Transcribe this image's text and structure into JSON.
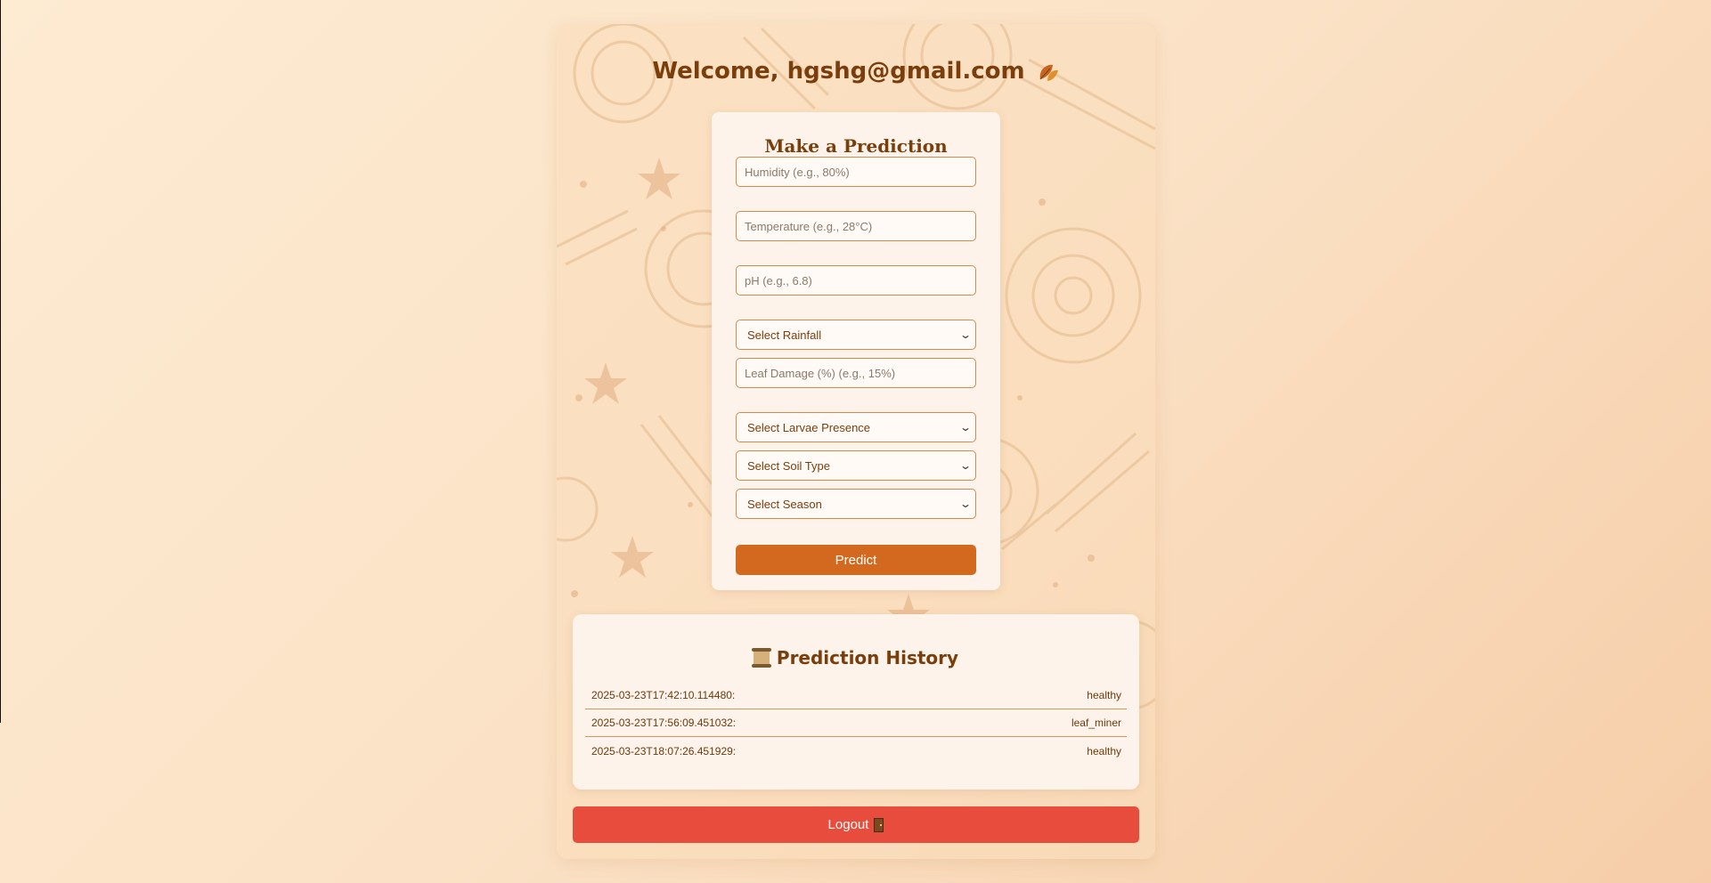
{
  "welcome": {
    "prefix": "Welcome, ",
    "email": "hgshg@gmail.com",
    "icon": "autumn-leaves-icon"
  },
  "form": {
    "title": "Make a Prediction",
    "humidity_placeholder": "Humidity (e.g., 80%)",
    "temperature_placeholder": "Temperature (e.g., 28°C)",
    "ph_placeholder": "pH (e.g., 6.8)",
    "rainfall_select": "Select Rainfall",
    "leaf_damage_placeholder": "Leaf Damage (%) (e.g., 15%)",
    "larvae_select": "Select Larvae Presence",
    "soil_select": "Select Soil Type",
    "season_select": "Select Season",
    "predict_label": "Predict"
  },
  "history": {
    "title": "Prediction History",
    "icon": "scroll-icon",
    "items": [
      {
        "timestamp": "2025-03-23T17:42:10.114480:",
        "result": "healthy"
      },
      {
        "timestamp": "2025-03-23T17:56:09.451032:",
        "result": "leaf_miner"
      },
      {
        "timestamp": "2025-03-23T18:07:26.451929:",
        "result": "healthy"
      }
    ]
  },
  "logout": {
    "label": "Logout",
    "icon": "door-icon"
  },
  "colors": {
    "accent": "#d2691e",
    "heading": "#7a3e0c",
    "logout": "#e74c3c",
    "card": "#fdf3ea"
  }
}
